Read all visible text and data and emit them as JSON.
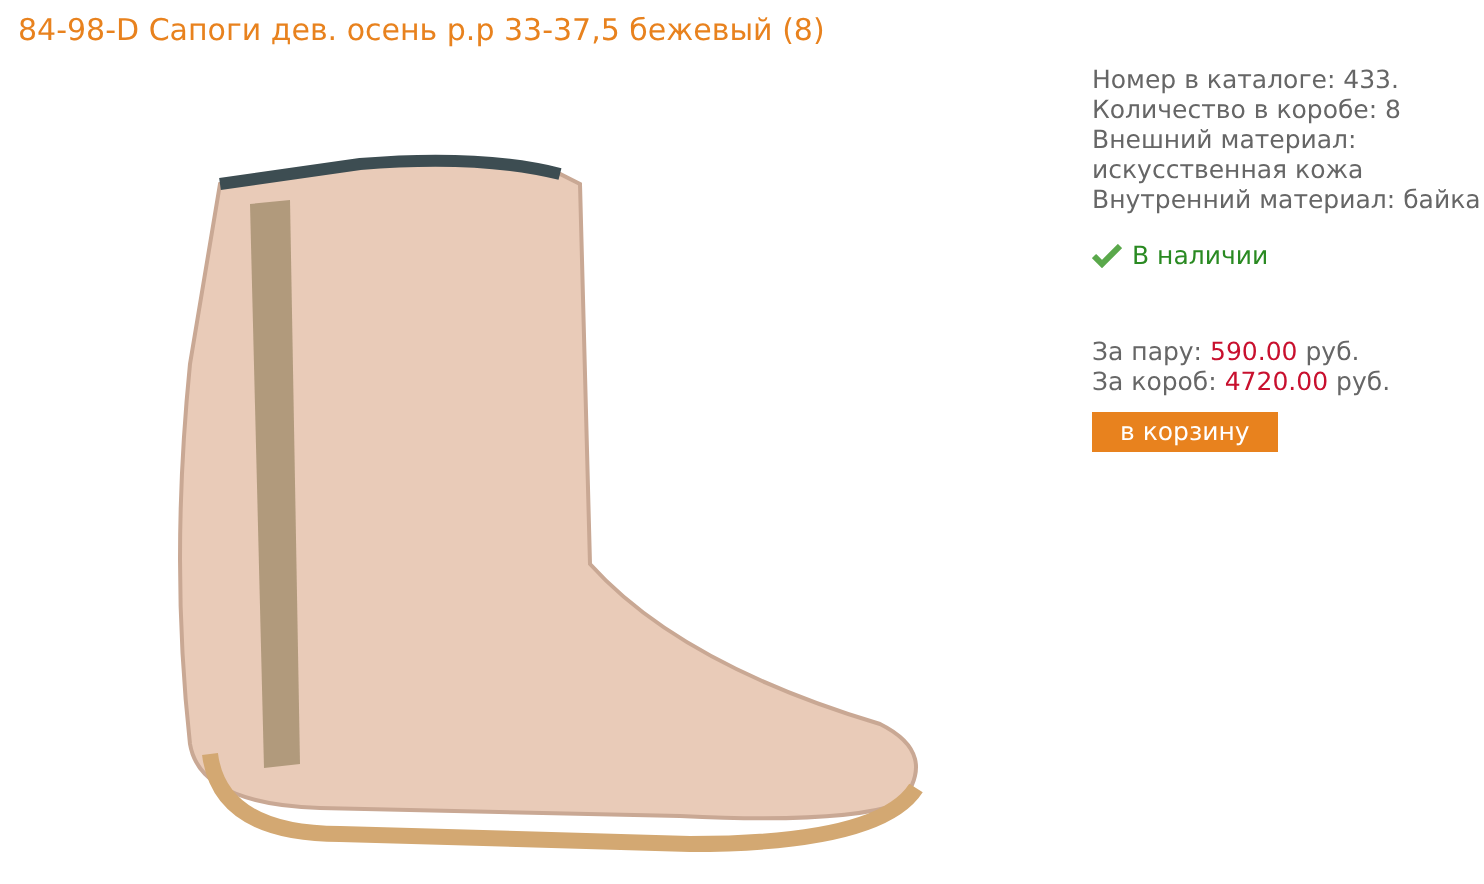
{
  "title": "84-98-D Сапоги дев. осень р.р 33-37,5 бежевый (8)",
  "specs": [
    "Номер в каталоге: 433.",
    "Количество в коробе: 8",
    "Внешний материал: искусственная кожа",
    "Внутренний материал: байка"
  ],
  "availability": "В наличии",
  "prices": [
    {
      "label": "За пару:",
      "value": "590.00",
      "unit": "руб."
    },
    {
      "label": "За короб:",
      "value": "4720.00",
      "unit": "руб."
    }
  ],
  "cart_button": "в корзину"
}
